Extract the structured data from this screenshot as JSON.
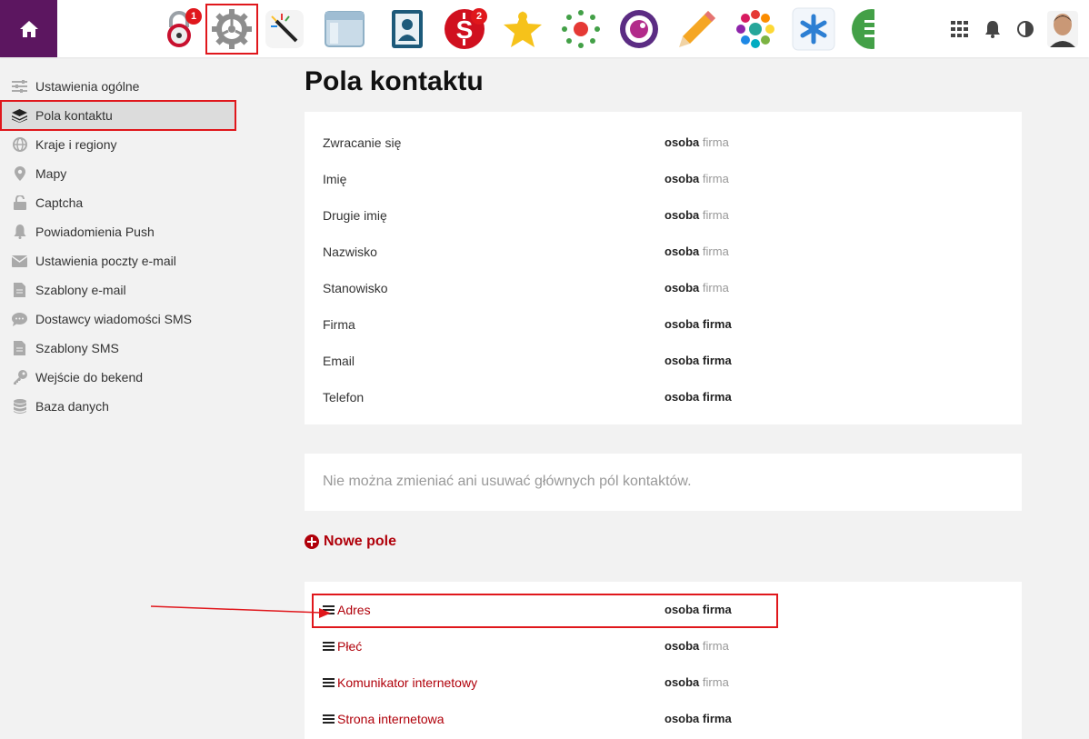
{
  "topbar": {
    "home_icon": "home-icon",
    "apps": [
      {
        "name": "lock-app",
        "icon": "padlock-icon",
        "badge": "1"
      },
      {
        "name": "settings-app",
        "icon": "gear-icon",
        "selected": true
      },
      {
        "name": "magic-wand-app",
        "icon": "magic-wand-icon"
      },
      {
        "name": "window-app",
        "icon": "browser-window-icon"
      },
      {
        "name": "contacts-app",
        "icon": "address-book-icon"
      },
      {
        "name": "shop-app",
        "icon": "dollar-sign-icon",
        "badge": "2"
      },
      {
        "name": "star-app",
        "icon": "star-person-icon"
      },
      {
        "name": "dots-app",
        "icon": "radial-dots-icon"
      },
      {
        "name": "camera-app",
        "icon": "lens-icon"
      },
      {
        "name": "pencil-app",
        "icon": "pencil-icon"
      },
      {
        "name": "colorful-app",
        "icon": "color-wheel-icon"
      },
      {
        "name": "asterisk-app",
        "icon": "asterisk-icon"
      },
      {
        "name": "green-app",
        "icon": "green-list-icon"
      }
    ],
    "right_icons": [
      "grid-icon",
      "bell-icon",
      "contrast-icon",
      "user-avatar"
    ]
  },
  "sidebar": {
    "items": [
      {
        "label": "Ustawienia ogólne",
        "icon": "sliders-icon"
      },
      {
        "label": "Pola kontaktu",
        "icon": "layers-icon",
        "active": true
      },
      {
        "label": "Kraje i regiony",
        "icon": "globe-icon"
      },
      {
        "label": "Mapy",
        "icon": "map-pin-icon"
      },
      {
        "label": "Captcha",
        "icon": "unlock-icon"
      },
      {
        "label": "Powiadomienia Push",
        "icon": "bell-icon"
      },
      {
        "label": "Ustawienia poczty e-mail",
        "icon": "envelope-icon"
      },
      {
        "label": "Szablony e-mail",
        "icon": "document-icon"
      },
      {
        "label": "Dostawcy wiadomości SMS",
        "icon": "sms-bubble-icon"
      },
      {
        "label": "Szablony SMS",
        "icon": "document-icon"
      },
      {
        "label": "Wejście do bekend",
        "icon": "key-icon"
      },
      {
        "label": "Baza danych",
        "icon": "database-icon"
      }
    ]
  },
  "main": {
    "title": "Pola kontaktu",
    "system_fields": [
      {
        "name": "Zwracanie się",
        "person": "osoba",
        "company": "firma",
        "company_on": false
      },
      {
        "name": "Imię",
        "person": "osoba",
        "company": "firma",
        "company_on": false
      },
      {
        "name": "Drugie imię",
        "person": "osoba",
        "company": "firma",
        "company_on": false
      },
      {
        "name": "Nazwisko",
        "person": "osoba",
        "company": "firma",
        "company_on": false
      },
      {
        "name": "Stanowisko",
        "person": "osoba",
        "company": "firma",
        "company_on": false
      },
      {
        "name": "Firma",
        "person": "osoba",
        "company": "firma",
        "company_on": true
      },
      {
        "name": "Email",
        "person": "osoba",
        "company": "firma",
        "company_on": true
      },
      {
        "name": "Telefon",
        "person": "osoba",
        "company": "firma",
        "company_on": true
      }
    ],
    "note": "Nie można zmieniać ani usuwać głównych pól kontaktów.",
    "new_field_label": "Nowe pole",
    "custom_fields": [
      {
        "name": "Adres",
        "person": "osoba",
        "company": "firma",
        "company_on": true
      },
      {
        "name": "Płeć",
        "person": "osoba",
        "company": "firma",
        "company_on": false
      },
      {
        "name": "Komunikator internetowy",
        "person": "osoba",
        "company": "firma",
        "company_on": false
      },
      {
        "name": "Strona internetowa",
        "person": "osoba",
        "company": "firma",
        "company_on": true
      }
    ]
  },
  "colors": {
    "brand": "#5c1660",
    "accent_red": "#b0000a",
    "annotation_red": "#e0171c"
  }
}
